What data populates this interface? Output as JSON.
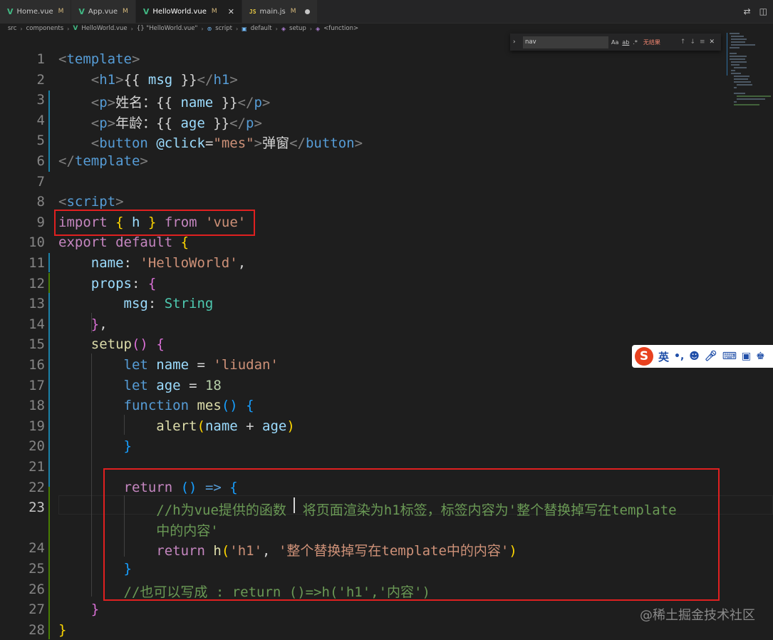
{
  "tabs": [
    {
      "icon": "vue-icon",
      "label": "Home.vue",
      "status": "M",
      "active": false
    },
    {
      "icon": "vue-icon",
      "label": "App.vue",
      "status": "M",
      "active": false
    },
    {
      "icon": "vue-icon",
      "label": "HelloWorld.vue",
      "status": "M",
      "active": true
    },
    {
      "icon": "js-icon",
      "label": "main.js",
      "status": "M",
      "active": false
    }
  ],
  "js_badge": "JS",
  "vue_badge": "V",
  "breadcrumb": [
    "src",
    "components",
    "HelloWorld.vue",
    "{} \"HelloWorld.vue\"",
    "script",
    "default",
    "setup",
    "<function>"
  ],
  "find": {
    "query": "nav",
    "match_case": "Aa",
    "whole_word": "ab",
    "regex": ".*",
    "result": "无结果"
  },
  "ime": {
    "logo": "S",
    "lang": "英"
  },
  "watermark": "@稀土掘金技术社区",
  "colors": {
    "background": "#1e1e1e",
    "keyword": "#c586c0",
    "string": "#ce9178",
    "comment": "#6a9955",
    "highlight_box": "#e02020"
  },
  "code_lines": [
    {
      "num": "1",
      "tokens": [
        [
          "t-bracket",
          "<"
        ],
        [
          "t-tag",
          "template"
        ],
        [
          "t-bracket",
          ">"
        ]
      ]
    },
    {
      "num": "2",
      "tokens": [
        [
          "t-text",
          "    "
        ],
        [
          "t-bracket",
          "<"
        ],
        [
          "t-tag",
          "h1"
        ],
        [
          "t-bracket",
          ">"
        ],
        [
          "t-text",
          "{{ "
        ],
        [
          "t-var",
          "msg"
        ],
        [
          "t-text",
          " }}"
        ],
        [
          "t-bracket",
          "</"
        ],
        [
          "t-tag",
          "h1"
        ],
        [
          "t-bracket",
          ">"
        ]
      ]
    },
    {
      "num": "3",
      "tokens": [
        [
          "t-text",
          "    "
        ],
        [
          "t-bracket",
          "<"
        ],
        [
          "t-tag",
          "p"
        ],
        [
          "t-bracket",
          ">"
        ],
        [
          "t-text",
          "姓名：{{ "
        ],
        [
          "t-var",
          "name"
        ],
        [
          "t-text",
          " }}"
        ],
        [
          "t-bracket",
          "</"
        ],
        [
          "t-tag",
          "p"
        ],
        [
          "t-bracket",
          ">"
        ]
      ]
    },
    {
      "num": "4",
      "tokens": [
        [
          "t-text",
          "    "
        ],
        [
          "t-bracket",
          "<"
        ],
        [
          "t-tag",
          "p"
        ],
        [
          "t-bracket",
          ">"
        ],
        [
          "t-text",
          "年龄：{{ "
        ],
        [
          "t-var",
          "age"
        ],
        [
          "t-text",
          " }}"
        ],
        [
          "t-bracket",
          "</"
        ],
        [
          "t-tag",
          "p"
        ],
        [
          "t-bracket",
          ">"
        ]
      ]
    },
    {
      "num": "5",
      "tokens": [
        [
          "t-text",
          "    "
        ],
        [
          "t-bracket",
          "<"
        ],
        [
          "t-tag",
          "button"
        ],
        [
          "t-text",
          " "
        ],
        [
          "t-var",
          "@click"
        ],
        [
          "t-text",
          "="
        ],
        [
          "t-str",
          "\"mes\""
        ],
        [
          "t-bracket",
          ">"
        ],
        [
          "t-text",
          "弹窗"
        ],
        [
          "t-bracket",
          "</"
        ],
        [
          "t-tag",
          "button"
        ],
        [
          "t-bracket",
          ">"
        ]
      ]
    },
    {
      "num": "6",
      "tokens": [
        [
          "t-bracket",
          "</"
        ],
        [
          "t-tag",
          "template"
        ],
        [
          "t-bracket",
          ">"
        ]
      ]
    },
    {
      "num": "7",
      "tokens": []
    },
    {
      "num": "8",
      "tokens": [
        [
          "t-bracket",
          "<"
        ],
        [
          "t-tag",
          "script"
        ],
        [
          "t-bracket",
          ">"
        ]
      ]
    },
    {
      "num": "9",
      "tokens": [
        [
          "t-kw",
          "import"
        ],
        [
          "t-text",
          " "
        ],
        [
          "t-b1",
          "{"
        ],
        [
          "t-text",
          " "
        ],
        [
          "t-var",
          "h"
        ],
        [
          "t-text",
          " "
        ],
        [
          "t-b1",
          "}"
        ],
        [
          "t-text",
          " "
        ],
        [
          "t-kw",
          "from"
        ],
        [
          "t-text",
          " "
        ],
        [
          "t-str",
          "'vue'"
        ]
      ]
    },
    {
      "num": "10",
      "tokens": [
        [
          "t-kw",
          "export"
        ],
        [
          "t-text",
          " "
        ],
        [
          "t-kw",
          "default"
        ],
        [
          "t-text",
          " "
        ],
        [
          "t-b1",
          "{"
        ]
      ]
    },
    {
      "num": "11",
      "tokens": [
        [
          "t-text",
          "    "
        ],
        [
          "t-var",
          "name"
        ],
        [
          "t-text",
          ": "
        ],
        [
          "t-str",
          "'HelloWorld'"
        ],
        [
          "t-text",
          ","
        ]
      ]
    },
    {
      "num": "12",
      "tokens": [
        [
          "t-text",
          "    "
        ],
        [
          "t-var",
          "props"
        ],
        [
          "t-text",
          ": "
        ],
        [
          "t-b2",
          "{"
        ]
      ]
    },
    {
      "num": "13",
      "tokens": [
        [
          "t-text",
          "        "
        ],
        [
          "t-var",
          "msg"
        ],
        [
          "t-text",
          ": "
        ],
        [
          "t-type",
          "String"
        ]
      ]
    },
    {
      "num": "14",
      "tokens": [
        [
          "t-text",
          "    "
        ],
        [
          "t-b2",
          "}"
        ],
        [
          "t-text",
          ","
        ]
      ]
    },
    {
      "num": "15",
      "tokens": [
        [
          "t-text",
          "    "
        ],
        [
          "t-func",
          "setup"
        ],
        [
          "t-b2",
          "()"
        ],
        [
          "t-text",
          " "
        ],
        [
          "t-b2",
          "{"
        ]
      ]
    },
    {
      "num": "16",
      "tokens": [
        [
          "t-text",
          "        "
        ],
        [
          "t-stor",
          "let"
        ],
        [
          "t-text",
          " "
        ],
        [
          "t-var",
          "name"
        ],
        [
          "t-text",
          " = "
        ],
        [
          "t-str",
          "'liudan'"
        ]
      ]
    },
    {
      "num": "17",
      "tokens": [
        [
          "t-text",
          "        "
        ],
        [
          "t-stor",
          "let"
        ],
        [
          "t-text",
          " "
        ],
        [
          "t-var",
          "age"
        ],
        [
          "t-text",
          " = "
        ],
        [
          "t-num",
          "18"
        ]
      ]
    },
    {
      "num": "18",
      "tokens": [
        [
          "t-text",
          "        "
        ],
        [
          "t-stor",
          "function"
        ],
        [
          "t-text",
          " "
        ],
        [
          "t-func",
          "mes"
        ],
        [
          "t-b3",
          "()"
        ],
        [
          "t-text",
          " "
        ],
        [
          "t-b3",
          "{"
        ]
      ]
    },
    {
      "num": "19",
      "tokens": [
        [
          "t-text",
          "            "
        ],
        [
          "t-func",
          "alert"
        ],
        [
          "t-b1",
          "("
        ],
        [
          "t-var",
          "name"
        ],
        [
          "t-text",
          " + "
        ],
        [
          "t-var",
          "age"
        ],
        [
          "t-b1",
          ")"
        ]
      ]
    },
    {
      "num": "20",
      "tokens": [
        [
          "t-text",
          "        "
        ],
        [
          "t-b3",
          "}"
        ]
      ]
    },
    {
      "num": "21",
      "tokens": []
    },
    {
      "num": "22",
      "tokens": [
        [
          "t-text",
          "        "
        ],
        [
          "t-kw",
          "return"
        ],
        [
          "t-text",
          " "
        ],
        [
          "t-b3",
          "()"
        ],
        [
          "t-text",
          " "
        ],
        [
          "t-stor",
          "=>"
        ],
        [
          "t-text",
          " "
        ],
        [
          "t-b3",
          "{"
        ]
      ]
    },
    {
      "num": "23",
      "tokens": [
        [
          "t-text",
          "            "
        ],
        [
          "t-com",
          "//h为vue提供的函数  将页面渲染为h1标签，标签内容为'整个替换掉写在template"
        ]
      ]
    },
    {
      "num": "",
      "tokens": [
        [
          "t-text",
          "            "
        ],
        [
          "t-com",
          "中的内容'"
        ]
      ]
    },
    {
      "num": "24",
      "tokens": [
        [
          "t-text",
          "            "
        ],
        [
          "t-kw",
          "return"
        ],
        [
          "t-text",
          " "
        ],
        [
          "t-func",
          "h"
        ],
        [
          "t-b1",
          "("
        ],
        [
          "t-str",
          "'h1'"
        ],
        [
          "t-text",
          ", "
        ],
        [
          "t-str",
          "'整个替换掉写在template中的内容'"
        ],
        [
          "t-b1",
          ")"
        ]
      ]
    },
    {
      "num": "25",
      "tokens": [
        [
          "t-text",
          "        "
        ],
        [
          "t-b3",
          "}"
        ]
      ]
    },
    {
      "num": "26",
      "tokens": [
        [
          "t-text",
          "        "
        ],
        [
          "t-com",
          "//也可以写成 : return ()=>h('h1','内容')"
        ]
      ]
    },
    {
      "num": "27",
      "tokens": [
        [
          "t-text",
          "    "
        ],
        [
          "t-b2",
          "}"
        ]
      ]
    },
    {
      "num": "28",
      "tokens": [
        [
          "t-b1",
          "}"
        ]
      ]
    }
  ]
}
